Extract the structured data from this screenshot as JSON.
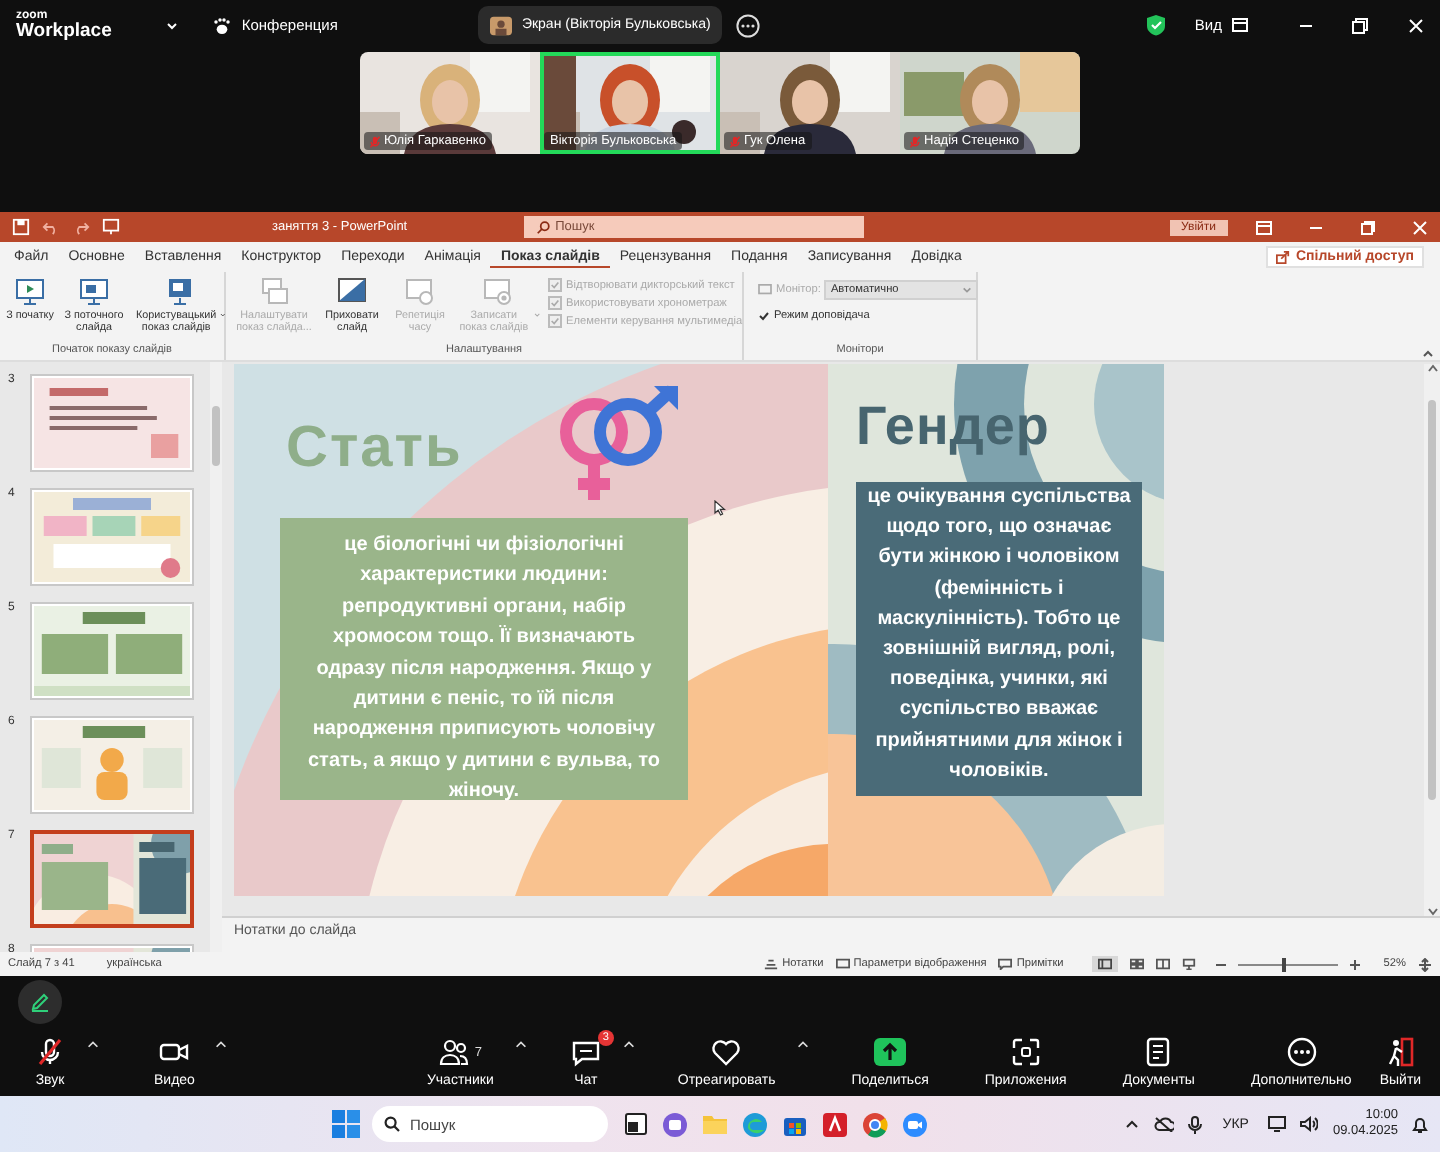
{
  "zoom_bar": {
    "logo_top": "zoom",
    "logo_bottom": "Workplace",
    "meeting": "Конференция",
    "share_pill": "Экран (Вікторія Бульковська)",
    "view": "Вид"
  },
  "participants": [
    {
      "name": "Юлія Гаркавенко",
      "muted": true,
      "active_speaker": false
    },
    {
      "name": "Вікторія Бульковська",
      "muted": false,
      "active_speaker": true
    },
    {
      "name": "Гук Олена",
      "muted": true,
      "active_speaker": false
    },
    {
      "name": "Надія Стеценко",
      "muted": true,
      "active_speaker": false
    }
  ],
  "powerpoint": {
    "title": "заняття 3 - PowerPoint",
    "search_placeholder": "Пошук",
    "sign_in": "Увійти",
    "share": "Спільний доступ"
  },
  "ribbon_tabs": [
    {
      "label": "Файл",
      "selected": false
    },
    {
      "label": "Основне",
      "selected": false
    },
    {
      "label": "Вставлення",
      "selected": false
    },
    {
      "label": "Конструктор",
      "selected": false
    },
    {
      "label": "Переходи",
      "selected": false
    },
    {
      "label": "Анімація",
      "selected": false
    },
    {
      "label": "Показ слайдів",
      "selected": true
    },
    {
      "label": "Рецензування",
      "selected": false
    },
    {
      "label": "Подання",
      "selected": false
    },
    {
      "label": "Записування",
      "selected": false
    },
    {
      "label": "Довідка",
      "selected": false
    }
  ],
  "ribbon": {
    "start_group": {
      "label": "Початок показу слайдів",
      "buttons": [
        {
          "label": "З початку",
          "kind": "play",
          "disabled": false,
          "dropdown": false
        },
        {
          "label": "З поточного слайда",
          "kind": "current",
          "disabled": false,
          "dropdown": false
        },
        {
          "label": "Користувацький показ слайдів",
          "kind": "custom",
          "disabled": false,
          "dropdown": true
        }
      ]
    },
    "setup_group": {
      "label": "Налаштування",
      "buttons": [
        {
          "label": "Налаштувати показ слайда...",
          "kind": "setup",
          "disabled": true,
          "dropdown": false
        },
        {
          "label": "Приховати слайд",
          "kind": "hide",
          "disabled": false,
          "dropdown": false
        },
        {
          "label": "Репетиція часу",
          "kind": "rehearse",
          "disabled": true,
          "dropdown": false
        },
        {
          "label": "Записати показ слайдів",
          "kind": "record",
          "disabled": true,
          "dropdown": true
        }
      ],
      "options": [
        {
          "label": "Відтворювати дикторський текст",
          "checked": true,
          "disabled": true
        },
        {
          "label": "Використовувати хронометраж",
          "checked": true,
          "disabled": true
        },
        {
          "label": "Елементи керування мультимедіа",
          "checked": true,
          "disabled": true
        }
      ]
    },
    "monitors_group": {
      "label": "Монітори",
      "monitor": {
        "label": "Монітор:",
        "value": "Автоматично",
        "disabled": true
      },
      "presenter_view": {
        "label": "Режим доповідача",
        "checked": true
      }
    }
  },
  "thumbnails": [
    {
      "number": "3",
      "kind": "text",
      "selected": false
    },
    {
      "number": "4",
      "kind": "cards",
      "selected": false
    },
    {
      "number": "5",
      "kind": "boxes",
      "selected": false
    },
    {
      "number": "6",
      "kind": "figure",
      "selected": false
    },
    {
      "number": "7",
      "kind": "split",
      "selected": true
    },
    {
      "number": "8",
      "kind": "split",
      "selected": false
    }
  ],
  "slide": {
    "left_title": "Стать",
    "left_text": "це біологічні чи фізіологічні характеристики людини: репродуктивні органи, набір хромосом тощо. Її визначають одразу після народження. Якщо у дитини є пеніс,  то їй після народження приписують чоловічу стать, а якщо у дитини є вульва, то жіночу.",
    "right_title": "Гендер",
    "right_text": "це очікування суспільства щодо того, що означає бути жінкою і чоловіком (фемінність і маскулінність). Тобто це зовнішній вигляд, ролі, поведінка, учинки, які суспільство вважає прийнятними для жінок і чоловіків."
  },
  "notes": {
    "placeholder": "Нотатки до слайда"
  },
  "status_bar": {
    "slide": "Слайд 7 з 41",
    "language": "українська",
    "notes": "Нотатки",
    "display": "Параметри відображення",
    "comments": "Примітки",
    "zoom": "52%",
    "zoom_slider": {
      "level": 0.45
    }
  },
  "meeting_controls": [
    {
      "kind": "audio",
      "label": "Звук",
      "muted": true,
      "menu": true
    },
    {
      "kind": "video",
      "label": "Видео",
      "muted": false,
      "menu": true
    },
    {
      "kind": "participants",
      "label": "Участники",
      "count": "7",
      "menu": true
    },
    {
      "kind": "chat",
      "label": "Чат",
      "badge": "3",
      "menu": true
    },
    {
      "kind": "react",
      "label": "Отреагировать",
      "menu": true
    },
    {
      "kind": "share",
      "label": "Поделиться",
      "menu": false
    },
    {
      "kind": "apps",
      "label": "Приложения",
      "menu": false
    },
    {
      "kind": "docs",
      "label": "Документы",
      "menu": false
    },
    {
      "kind": "more",
      "label": "Дополнительно",
      "menu": false
    },
    {
      "kind": "leave",
      "label": "Выйти",
      "menu": false
    }
  ],
  "taskbar": {
    "search_placeholder": "Пошук",
    "language": "УКР",
    "time": "10:00",
    "date": "09.04.2025"
  }
}
